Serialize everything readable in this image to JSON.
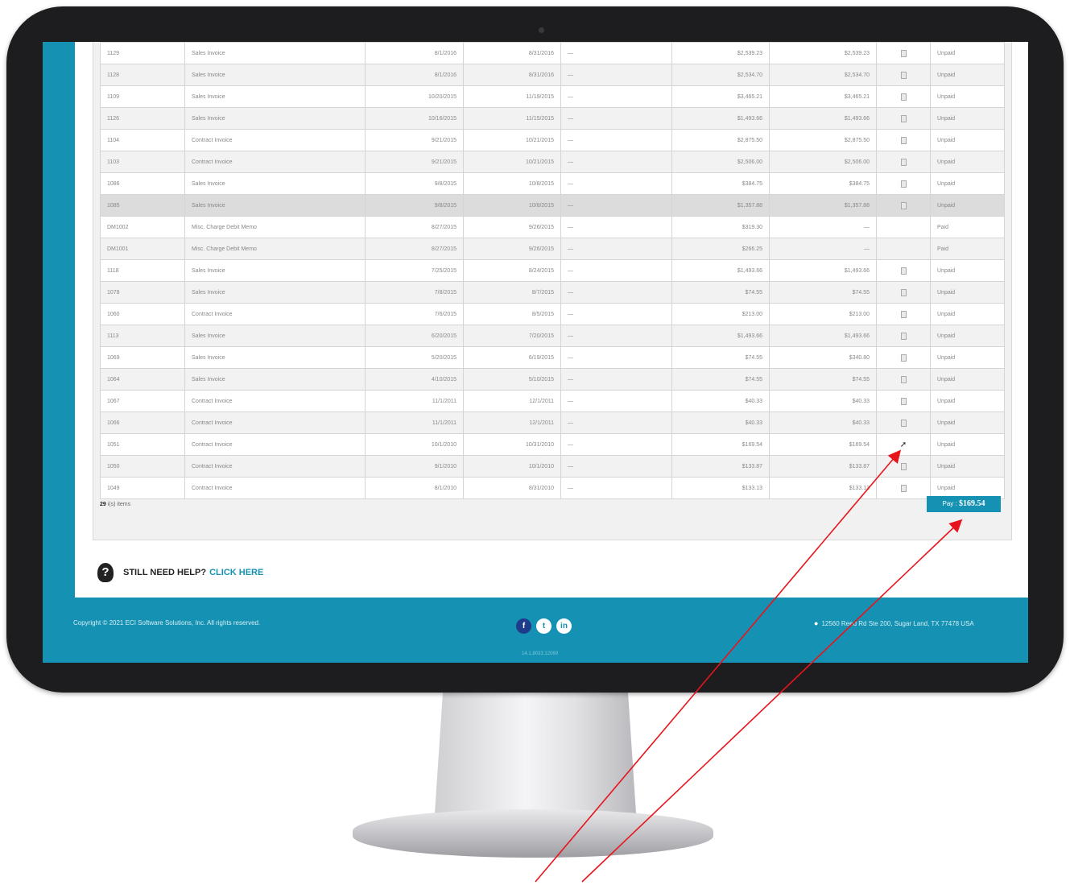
{
  "invoices": [
    {
      "num": "1129",
      "type": "Sales Invoice",
      "date": "8/1/2016",
      "due": "8/31/2016",
      "ref": "—",
      "amount": "$2,539.23",
      "balance": "$2,539.23",
      "doc": true,
      "status": "Unpaid"
    },
    {
      "num": "1128",
      "type": "Sales Invoice",
      "date": "8/1/2016",
      "due": "8/31/2016",
      "ref": "—",
      "amount": "$2,534.70",
      "balance": "$2,534.70",
      "doc": true,
      "status": "Unpaid"
    },
    {
      "num": "1109",
      "type": "Sales Invoice",
      "date": "10/20/2015",
      "due": "11/19/2015",
      "ref": "—",
      "amount": "$3,465.21",
      "balance": "$3,465.21",
      "doc": true,
      "status": "Unpaid"
    },
    {
      "num": "1126",
      "type": "Sales Invoice",
      "date": "10/16/2015",
      "due": "11/15/2015",
      "ref": "—",
      "amount": "$1,493.66",
      "balance": "$1,493.66",
      "doc": true,
      "status": "Unpaid"
    },
    {
      "num": "1104",
      "type": "Contract Invoice",
      "date": "9/21/2015",
      "due": "10/21/2015",
      "ref": "—",
      "amount": "$2,875.50",
      "balance": "$2,875.50",
      "doc": true,
      "status": "Unpaid"
    },
    {
      "num": "1103",
      "type": "Contract Invoice",
      "date": "9/21/2015",
      "due": "10/21/2015",
      "ref": "—",
      "amount": "$2,506.00",
      "balance": "$2,506.00",
      "doc": true,
      "status": "Unpaid"
    },
    {
      "num": "1086",
      "type": "Sales Invoice",
      "date": "9/8/2015",
      "due": "10/8/2015",
      "ref": "—",
      "amount": "$384.75",
      "balance": "$384.75",
      "doc": true,
      "status": "Unpaid"
    },
    {
      "num": "1085",
      "type": "Sales Invoice",
      "date": "9/8/2015",
      "due": "10/8/2015",
      "ref": "—",
      "amount": "$1,357.88",
      "balance": "$1,357.88",
      "doc": true,
      "status": "Unpaid"
    },
    {
      "num": "DM1002",
      "type": "Misc. Charge Debit Memo",
      "date": "8/27/2015",
      "due": "9/26/2015",
      "ref": "—",
      "amount": "$319.30",
      "balance": "—",
      "doc": false,
      "status": "Paid"
    },
    {
      "num": "DM1001",
      "type": "Misc. Charge Debit Memo",
      "date": "8/27/2015",
      "due": "9/26/2015",
      "ref": "—",
      "amount": "$266.25",
      "balance": "—",
      "doc": false,
      "status": "Paid"
    },
    {
      "num": "1118",
      "type": "Sales Invoice",
      "date": "7/25/2015",
      "due": "8/24/2015",
      "ref": "—",
      "amount": "$1,493.66",
      "balance": "$1,493.66",
      "doc": true,
      "status": "Unpaid"
    },
    {
      "num": "1078",
      "type": "Sales Invoice",
      "date": "7/8/2015",
      "due": "8/7/2015",
      "ref": "—",
      "amount": "$74.55",
      "balance": "$74.55",
      "doc": true,
      "status": "Unpaid"
    },
    {
      "num": "1060",
      "type": "Contract Invoice",
      "date": "7/6/2015",
      "due": "8/5/2015",
      "ref": "—",
      "amount": "$213.00",
      "balance": "$213.00",
      "doc": true,
      "status": "Unpaid"
    },
    {
      "num": "1113",
      "type": "Sales Invoice",
      "date": "6/20/2015",
      "due": "7/20/2015",
      "ref": "—",
      "amount": "$1,493.66",
      "balance": "$1,493.66",
      "doc": true,
      "status": "Unpaid"
    },
    {
      "num": "1069",
      "type": "Sales Invoice",
      "date": "5/20/2015",
      "due": "6/19/2015",
      "ref": "—",
      "amount": "$74.55",
      "balance": "$340.80",
      "doc": true,
      "status": "Unpaid"
    },
    {
      "num": "1064",
      "type": "Sales Invoice",
      "date": "4/10/2015",
      "due": "5/10/2015",
      "ref": "—",
      "amount": "$74.55",
      "balance": "$74.55",
      "doc": true,
      "status": "Unpaid"
    },
    {
      "num": "1067",
      "type": "Contract Invoice",
      "date": "11/1/2011",
      "due": "12/1/2011",
      "ref": "—",
      "amount": "$40.33",
      "balance": "$40.33",
      "doc": true,
      "status": "Unpaid"
    },
    {
      "num": "1066",
      "type": "Contract Invoice",
      "date": "11/1/2011",
      "due": "12/1/2011",
      "ref": "—",
      "amount": "$40.33",
      "balance": "$40.33",
      "doc": true,
      "status": "Unpaid"
    },
    {
      "num": "1051",
      "type": "Contract Invoice",
      "date": "10/1/2010",
      "due": "10/31/2010",
      "ref": "—",
      "amount": "$169.54",
      "balance": "$169.54",
      "doc": false,
      "status": "Unpaid"
    },
    {
      "num": "1050",
      "type": "Contract Invoice",
      "date": "9/1/2010",
      "due": "10/1/2010",
      "ref": "—",
      "amount": "$133.87",
      "balance": "$133.87",
      "doc": true,
      "status": "Unpaid"
    },
    {
      "num": "1049",
      "type": "Contract Invoice",
      "date": "8/1/2010",
      "due": "8/31/2010",
      "ref": "—",
      "amount": "$133.13",
      "balance": "$133.13",
      "doc": true,
      "status": "Unpaid"
    }
  ],
  "highlighted_row": 7,
  "cursor_row": 18,
  "summary": {
    "count": "29",
    "count_suffix": "i(s) items"
  },
  "pay_button": {
    "label": "Pay : ",
    "amount": "$169.54"
  },
  "help": {
    "text": "STILL NEED HELP?",
    "link": "CLICK HERE"
  },
  "footer": {
    "copyright": "Copyright © 2021 ECI Software Solutions, Inc. All rights reserved.",
    "version": "14.1.8033.12069",
    "address": "12560 Reed Rd Ste 200, Sugar Land, TX 77478 USA",
    "social": [
      {
        "icon": "facebook-icon",
        "glyph": "f"
      },
      {
        "icon": "twitter-icon",
        "glyph": "t"
      },
      {
        "icon": "linkedin-icon",
        "glyph": "in"
      }
    ]
  },
  "colors": {
    "accent": "#1592b3",
    "annotation": "#e8141c",
    "bezel": "#1d1d1f"
  }
}
